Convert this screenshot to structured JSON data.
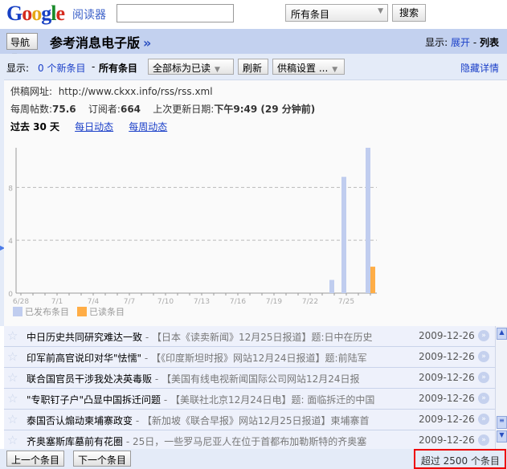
{
  "header": {
    "logo": "Google",
    "product": "阅读器",
    "search_value": "",
    "scope": "所有条目",
    "search_button": "搜索"
  },
  "feedbar": {
    "nav_button": "导航",
    "title": "参考消息电子版",
    "title_chevron": "»",
    "view_label": "显示:",
    "view_expanded": "展开",
    "view_sep": "-",
    "view_list": "列表"
  },
  "toolbar": {
    "show_label": "显示:",
    "new_items": "0 个新条目",
    "sep": "-",
    "all_items": "所有条目",
    "mark_all_read": "全部标为已读",
    "refresh": "刷新",
    "feed_settings": "供稿设置 ...",
    "hide_details": "隐藏详情"
  },
  "details": {
    "feed_url_label": "供稿网址:",
    "feed_url": "http://www.ckxx.info/rss/rss.xml",
    "posts_label": "每周帖数:",
    "posts": "75.6",
    "subs_label": "订阅者:",
    "subs": "664",
    "updated_label": "上次更新日期:",
    "updated": "下午9:49 (29 分钟前)",
    "range": "过去 30 天",
    "daily_link": "每日动态",
    "weekly_link": "每周动态"
  },
  "chart_data": {
    "type": "bar",
    "xlabel": "",
    "ylabel": "",
    "ylim": [
      0,
      11
    ],
    "yticks": [
      0,
      4,
      8
    ],
    "grid": true,
    "legend_position": "bottom-left",
    "xtick_labels": [
      "6/28",
      "7/1",
      "7/4",
      "7/7",
      "7/10",
      "7/13",
      "7/16",
      "7/19",
      "7/22",
      "7/25"
    ],
    "categories": [
      "7/24",
      "7/25",
      "7/27"
    ],
    "series": [
      {
        "name": "已发布条目",
        "color": "#c0cdef",
        "values": [
          1,
          8.8,
          11
        ]
      },
      {
        "name": "已读条目",
        "color": "#ffad46",
        "values": [
          0,
          0,
          2
        ]
      }
    ]
  },
  "items": [
    {
      "title": "中日历史共同研究难达一致",
      "snippet": " - 【日本《读卖新闻》12月25日报道】题:日中在历史",
      "date": "2009-12-26"
    },
    {
      "title": "印军前高官说印对华\"怯懦\"",
      "snippet": " - 【《印度斯坦时报》网站12月24日报道】题:前陆军",
      "date": "2009-12-26"
    },
    {
      "title": "联合国官员干涉我处决英毒贩",
      "snippet": " - 【美国有线电视新闻国际公司网站12月24日报",
      "date": "2009-12-26"
    },
    {
      "title": "\"专职钉子户\"凸显中国拆迁问题",
      "snippet": " - 【美联社北京12月24日电】题: 面临拆迁的中国",
      "date": "2009-12-26"
    },
    {
      "title": "泰国否认煽动柬埔寨政变",
      "snippet": " - 【新加坡《联合早报》网站12月25日报道】柬埔寨首",
      "date": "2009-12-26"
    },
    {
      "title": "齐奥塞斯库墓前有花圈",
      "snippet": " - 25日，一些罗马尼亚人在位于首都布加勒斯特的齐奥塞",
      "date": "2009-12-26"
    }
  ],
  "footer": {
    "prev": "上一个条目",
    "next": "下一个条目",
    "count": "超过 2500 个条目"
  }
}
